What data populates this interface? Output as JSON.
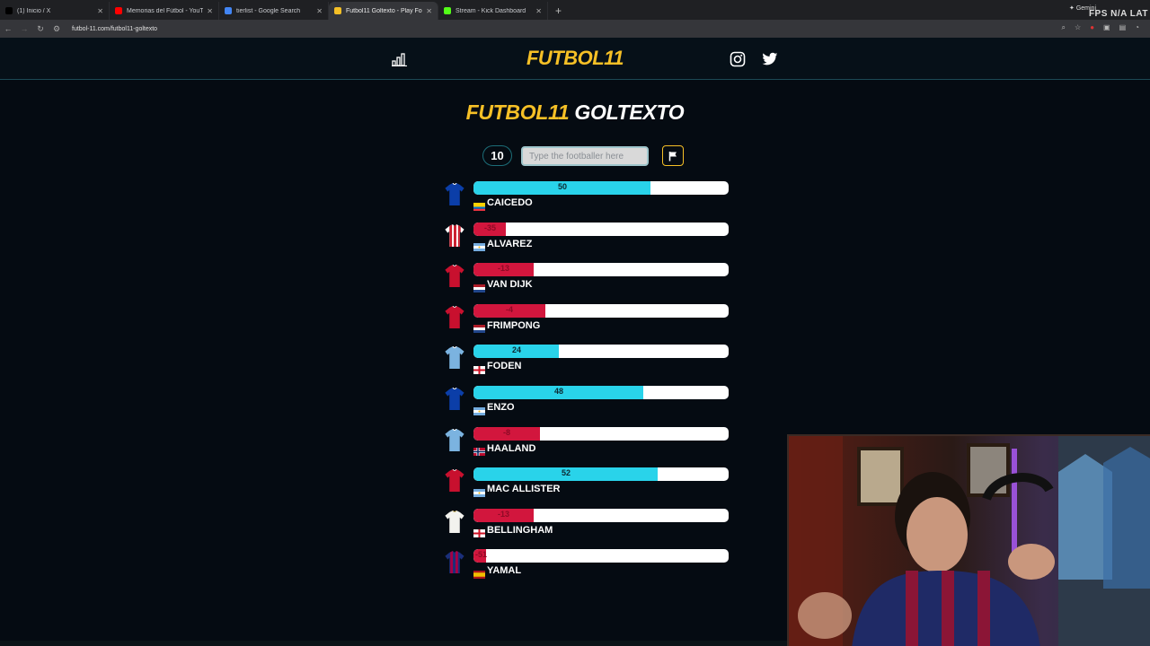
{
  "browser": {
    "tabs": [
      {
        "title": "(1) Inicio / X",
        "fav": "#000000"
      },
      {
        "title": "Memorias del Fútbol - YouTube",
        "fav": "#ff0000"
      },
      {
        "title": "tierlist - Google Search",
        "fav": "#4285f4"
      },
      {
        "title": "Futbol11 Goltexto - Play Footb...",
        "fav": "#f6c026"
      },
      {
        "title": "Stream - Kick Dashboard",
        "fav": "#53fc18"
      }
    ],
    "active_tab": 3,
    "url": "futbol-11.com/futbol11-goltexto",
    "gemini_label": "✦ Gemini",
    "fps_label": "FPS N/A  LAT"
  },
  "header": {
    "logo_text": "FUTBOL11",
    "stats_icon": "bar-chart-icon",
    "social_icons": [
      "instagram-icon",
      "twitter-icon"
    ]
  },
  "game": {
    "title_yellow": "FUTBOL11",
    "title_white": " GOLTEXTO",
    "attempts": "10",
    "search_placeholder": "Type the footballer here",
    "flag_icon": "flag-icon"
  },
  "colors": {
    "accent_yellow": "#f6c026",
    "positive": "#29d3ea",
    "negative": "#d2163d"
  },
  "players": [
    {
      "name": "CAICEDO",
      "value": 50,
      "nation": "ecuador",
      "shirt": "chelsea"
    },
    {
      "name": "ALVAREZ",
      "value": -35,
      "nation": "argentina",
      "shirt": "atletico"
    },
    {
      "name": "VAN DIJK",
      "value": -13,
      "nation": "netherlands",
      "shirt": "liverpool"
    },
    {
      "name": "FRIMPONG",
      "value": -4,
      "nation": "netherlands",
      "shirt": "liverpool"
    },
    {
      "name": "FODEN",
      "value": 24,
      "nation": "england",
      "shirt": "mancity"
    },
    {
      "name": "ENZO",
      "value": 48,
      "nation": "argentina",
      "shirt": "chelsea"
    },
    {
      "name": "HAALAND",
      "value": -8,
      "nation": "norway",
      "shirt": "mancity"
    },
    {
      "name": "MAC ALLISTER",
      "value": 52,
      "nation": "argentina",
      "shirt": "liverpool"
    },
    {
      "name": "BELLINGHAM",
      "value": -13,
      "nation": "england",
      "shirt": "realmadrid"
    },
    {
      "name": "YAMAL",
      "value": -51,
      "nation": "spain",
      "shirt": "barcelona"
    }
  ]
}
